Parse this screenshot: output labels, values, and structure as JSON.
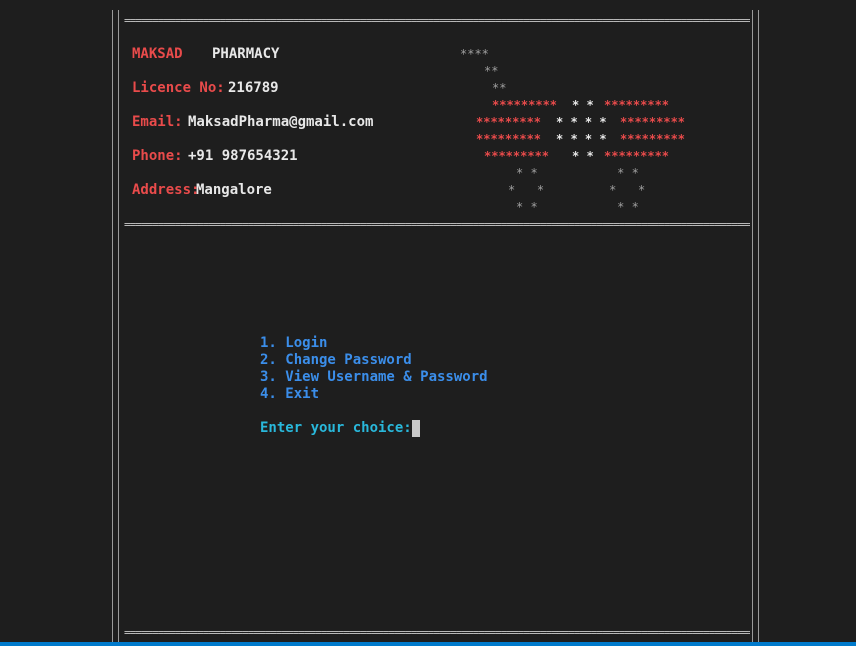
{
  "border": {
    "rule": "================================================================================================================"
  },
  "header": {
    "brand_name": "MAKSAD",
    "brand_suffix": "PHARMACY",
    "licence_label": "Licence No:",
    "licence_value": "216789",
    "email_label": "Email:",
    "email_value": "MaksadPharma@gmail.com",
    "phone_label": "Phone:",
    "phone_value": "+91 987654321",
    "address_label": "Address:",
    "address_value": "Mangalore"
  },
  "logo": {
    "r1": "****",
    "r2": "**",
    "r3": "**",
    "r4a": "*********",
    "r4b": "* *",
    "r4c": "*********",
    "r5a": "*********",
    "r5b": "* * * *",
    "r5c": "*********",
    "r6a": "*********",
    "r6b": "* * * *",
    "r6c": "*********",
    "r7a": "*********",
    "r7b": "* *",
    "r7c": "*********",
    "r8": "* *           * *",
    "r9": "*   *         *   *",
    "r10": "* *           * *"
  },
  "menu": {
    "items": [
      "1. Login",
      "2. Change Password",
      "3. View Username & Password",
      "4. Exit"
    ],
    "prompt": "Enter your choice:"
  },
  "colors": {
    "background": "#1e1e1e",
    "label_red": "#e94b4b",
    "menu_blue": "#3b8eea",
    "prompt_cyan": "#29b8db"
  }
}
